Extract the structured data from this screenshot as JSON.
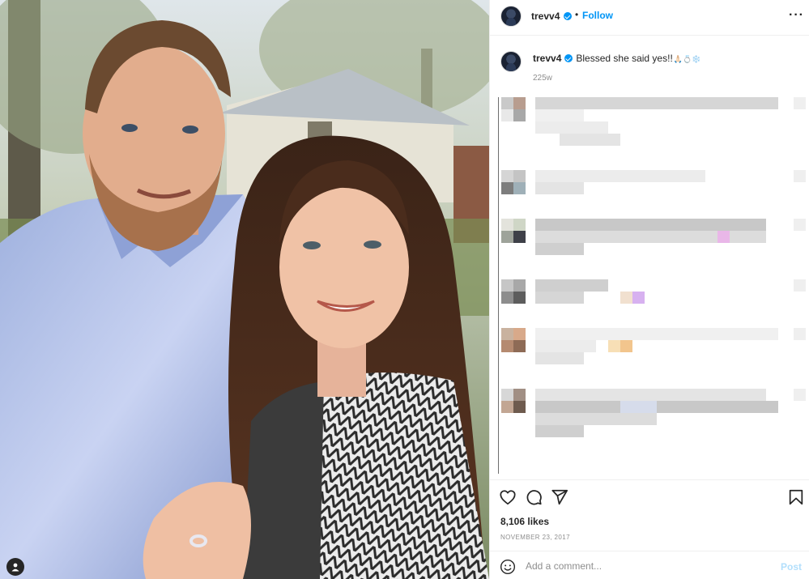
{
  "post": {
    "username": "trevv4",
    "follow_label": "Follow",
    "separator": "•",
    "more_label": "···",
    "caption": {
      "username": "trevv4",
      "text": "Blessed she said yes!!",
      "emojis": [
        "🙏🏻",
        "💍",
        "❄️"
      ],
      "age": "225w"
    },
    "likes": "8,106 likes",
    "date": "NOVEMBER 23, 2017",
    "comment_placeholder": "Add a comment...",
    "post_label": "Post"
  },
  "icons": {
    "more": "more-horizontal-icon",
    "like": "heart-icon",
    "comment": "comment-bubble-icon",
    "share": "paper-plane-icon",
    "save": "bookmark-icon",
    "emoji": "smiley-face-icon",
    "tag": "tagged-user-icon",
    "verified": "verified-badge-icon"
  },
  "colors": {
    "accent": "#0095f6",
    "post_disabled": "#b2dffc",
    "muted": "#8e8e8e",
    "text": "#262626"
  }
}
